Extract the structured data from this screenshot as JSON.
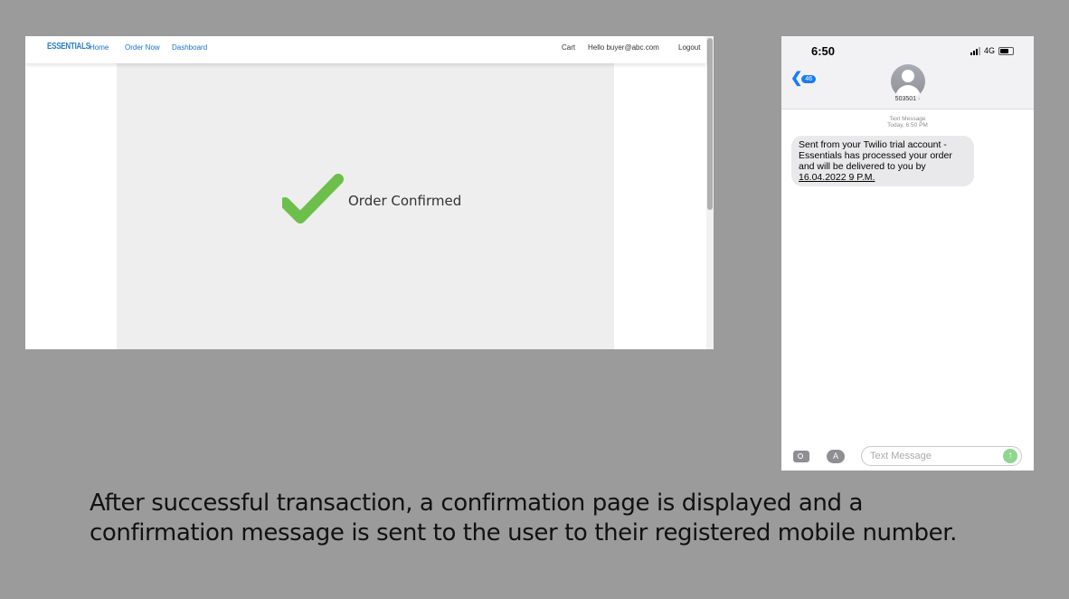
{
  "web": {
    "brand": "ESSENTIALS",
    "nav": {
      "home": "Home",
      "order_now": "Order Now",
      "dashboard": "Dashboard"
    },
    "right": {
      "cart": "Cart",
      "greeting": "Hello buyer@abc.com",
      "logout": "Logout"
    },
    "main": {
      "status_text": "Order Confirmed",
      "check_color": "#6cbf4a"
    }
  },
  "phone": {
    "time": "6:50",
    "network": "4G",
    "back_count": "46",
    "contact": "503501",
    "meta_type": "Text Message",
    "meta_time": "Today, 6:50 PM",
    "message_part1": "Sent from your Twilio trial account - Essentials has processed your order and will be delivered to you by ",
    "message_date": "16.04.2022 9 P.M.",
    "input_placeholder": "Text Message"
  },
  "caption": "After successful transaction, a confirmation page is displayed and a confirmation message is sent to the user to their registered mobile number."
}
